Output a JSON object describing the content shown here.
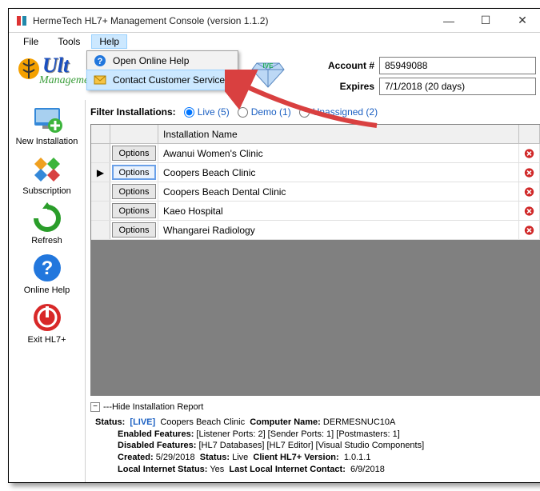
{
  "window": {
    "title": "HermeTech HL7+ Management Console  (version 1.1.2)"
  },
  "menubar": {
    "file": "File",
    "tools": "Tools",
    "help": "Help"
  },
  "help_menu": {
    "open_online": "Open Online Help",
    "contact": "Contact Customer Service"
  },
  "logo": {
    "main": "Ult",
    "sub": "Management C",
    "badge": "IVE"
  },
  "fields": {
    "account_label": "Account #",
    "account_value": "85949088",
    "expires_label": "Expires",
    "expires_value": "7/1/2018 (20 days)"
  },
  "sidebar": {
    "new_install": "New Installation",
    "subscription": "Subscription",
    "refresh": "Refresh",
    "online_help": "Online Help",
    "exit": "Exit HL7+"
  },
  "filter": {
    "label": "Filter Installations:",
    "live": "Live (5)",
    "demo": "Demo (1)",
    "unassigned": "Unassigned (2)"
  },
  "grid": {
    "col_name": "Installation Name",
    "options_label": "Options",
    "rows": [
      {
        "name": "Awanui Women's Clinic"
      },
      {
        "name": "Coopers Beach Clinic"
      },
      {
        "name": "Coopers Beach Dental Clinic"
      },
      {
        "name": "Kaeo Hospital"
      },
      {
        "name": "Whangarei Radiology"
      }
    ]
  },
  "report_toggle": "---Hide Installation Report",
  "report": {
    "status_lbl": "Status:",
    "live": "[LIVE]",
    "inst_name": "Coopers Beach Clinic",
    "comp_lbl": "Computer Name:",
    "comp_val": "DERMESNUC10A",
    "feat_lbl": "Enabled Features:",
    "feat_val": "[Listener Ports: 2] [Sender Ports: 1] [Postmasters: 1]",
    "dfeat_lbl": "Disabled Features:",
    "dfeat_val": "[HL7 Databases]  [HL7 Editor] [Visual Studio Components]",
    "created_lbl": "Created:",
    "created_val": "5/29/2018",
    "status2_lbl": "Status:",
    "status2_val": "Live",
    "ver_lbl": "Client HL7+ Version:",
    "ver_val": "1.0.1.1",
    "net_lbl": "Local Internet Status:",
    "net_val": "Yes",
    "last_lbl": "Last Local Internet Contact:",
    "last_val": "6/9/2018"
  }
}
